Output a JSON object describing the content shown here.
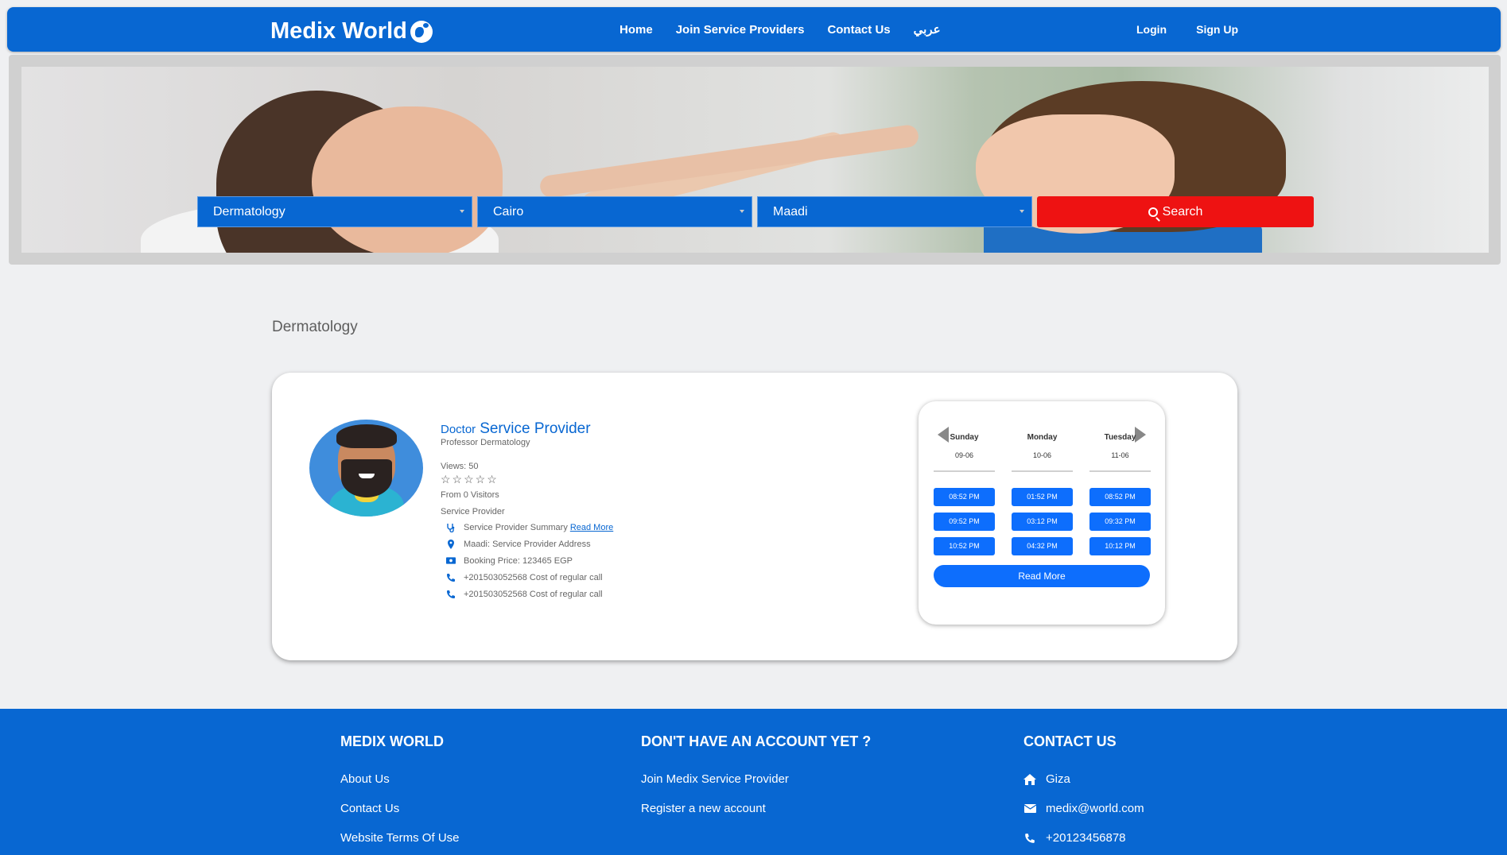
{
  "nav": {
    "logo": "Medix World",
    "links": [
      "Home",
      "Join Service Providers",
      "Contact Us",
      "عربي"
    ],
    "login": "Login",
    "signup": "Sign Up"
  },
  "search": {
    "specialty": "Dermatology",
    "city": "Cairo",
    "area": "Maadi",
    "button": "Search"
  },
  "section_title": "Dermatology",
  "doctor": {
    "prefix": "Doctor",
    "name": "Service Provider",
    "title": "Professor Dermatology",
    "views": "Views: 50",
    "stars": "☆☆☆☆☆",
    "rating_count": 0,
    "visitors": "From 0 Visitors",
    "provider": "Service Provider",
    "summary": "Service Provider Summary",
    "summary_link": "Read More",
    "address": "Maadi: Service Provider Address",
    "price": "Booking Price: 123465 EGP",
    "phone1": "+201503052568 Cost of regular call",
    "phone2": "+201503052568 Cost of regular call"
  },
  "schedule": {
    "days": [
      {
        "day": "Sunday",
        "date": "09-06",
        "slots": [
          "08:52 PM",
          "09:52 PM",
          "10:52 PM"
        ]
      },
      {
        "day": "Monday",
        "date": "10-06",
        "slots": [
          "01:52 PM",
          "03:12 PM",
          "04:32 PM"
        ]
      },
      {
        "day": "Tuesday",
        "date": "11-06",
        "slots": [
          "08:52 PM",
          "09:32 PM",
          "10:12 PM"
        ]
      }
    ],
    "read_more": "Read More"
  },
  "footer": {
    "col1": {
      "title": "MEDIX WORLD",
      "links": [
        "About Us",
        "Contact Us",
        "Website Terms Of Use"
      ]
    },
    "col2": {
      "title": "DON'T HAVE AN ACCOUNT YET ?",
      "links": [
        "Join Medix Service Provider",
        "Register a new account"
      ]
    },
    "col3": {
      "title": "CONTACT US",
      "address": "Giza",
      "email": "medix@world.com",
      "phone": "+20123456878"
    }
  },
  "colors": {
    "primary": "#0867d2",
    "search_button": "#ee1212",
    "slot": "#0d6efd"
  },
  "icons": [
    "globe-icon",
    "search-icon",
    "stethoscope-icon",
    "location-icon",
    "money-icon",
    "phone-icon",
    "home-icon",
    "mail-icon"
  ]
}
